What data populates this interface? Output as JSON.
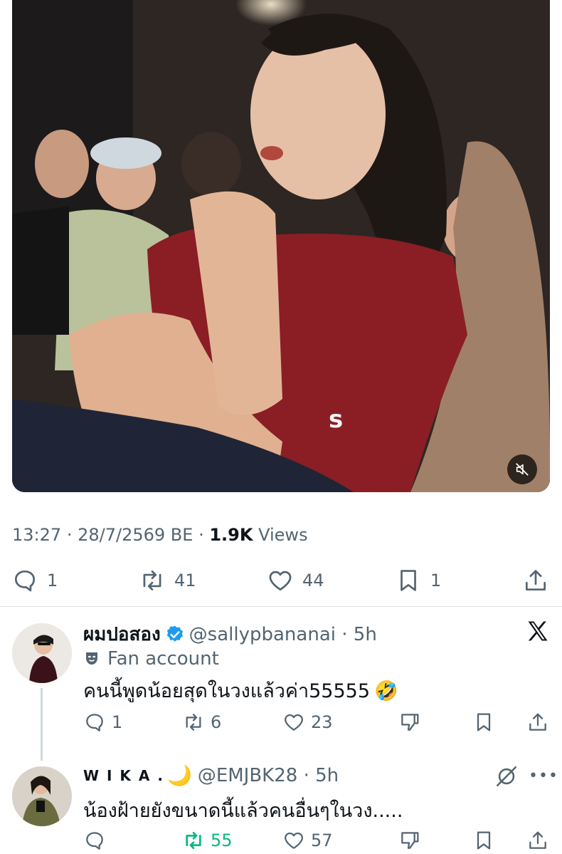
{
  "tweet": {
    "time": "13:27",
    "separator": "·",
    "date": "28/7/2569 BE",
    "views_count": "1.9K",
    "views_label": "Views",
    "stats": {
      "replies": "1",
      "reposts": "41",
      "likes": "44",
      "bookmarks": "1"
    }
  },
  "replies": [
    {
      "display_name": "ผมปอสอง",
      "handle": "@sallypbananai",
      "time": "5h",
      "verified": true,
      "label": "Fan account",
      "text": "คนนี้พูดน้อยสุดในวงแล้วค่า55555",
      "emoji": "🤣",
      "stats": {
        "replies": "1",
        "reposts": "6",
        "likes": "23"
      }
    },
    {
      "display_name": "W I K A .",
      "name_emoji": "🌙",
      "handle": "@EMJBK28",
      "time": "5h",
      "text": "น้องฝ้ายยังขนาดนี้แล้วคนอื่นๆในวง.....",
      "stats": {
        "replies": "",
        "reposts": "55",
        "likes": "57"
      }
    }
  ],
  "icons": {
    "mute": "speaker-muted-icon",
    "reply": "reply-bubble-icon",
    "repost": "repost-icon",
    "like": "heart-icon",
    "bookmark": "bookmark-icon",
    "share": "share-icon",
    "dislike": "downvote-icon",
    "x_logo": "x-logo-icon",
    "grok": "grok-icon",
    "more": "more-icon"
  },
  "colors": {
    "text_primary": "#0f1419",
    "text_secondary": "#536471",
    "verified_blue": "#1d9bf0",
    "repost_green": "#00ba7c"
  }
}
